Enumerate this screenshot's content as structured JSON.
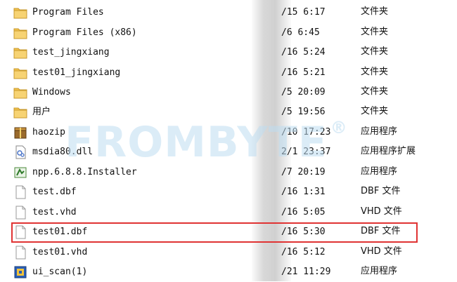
{
  "rows": [
    {
      "name": "Program Files",
      "date": "/15 6:17",
      "type": "文件夹",
      "icon": "folder-icon"
    },
    {
      "name": "Program Files (x86)",
      "date": "/6 6:45",
      "type": "文件夹",
      "icon": "folder-icon"
    },
    {
      "name": "test_jingxiang",
      "date": "/16 5:24",
      "type": "文件夹",
      "icon": "folder-icon"
    },
    {
      "name": "test01_jingxiang",
      "date": "/16 5:21",
      "type": "文件夹",
      "icon": "folder-icon"
    },
    {
      "name": "Windows",
      "date": "/5 20:09",
      "type": "文件夹",
      "icon": "folder-icon"
    },
    {
      "name": "用户",
      "date": "/5 19:56",
      "type": "文件夹",
      "icon": "folder-icon"
    },
    {
      "name": "haozip",
      "date": "/10 17:23",
      "type": "应用程序",
      "icon": "haozip-app-icon"
    },
    {
      "name": "msdia80.dll",
      "date": "2/1 23:37",
      "type": "应用程序扩展",
      "icon": "dll-file-icon"
    },
    {
      "name": "npp.6.8.8.Installer",
      "date": "/7 20:19",
      "type": "应用程序",
      "icon": "installer-app-icon"
    },
    {
      "name": "test.dbf",
      "date": "/16 1:31",
      "type": "DBF 文件",
      "icon": "blank-file-icon"
    },
    {
      "name": "test.vhd",
      "date": "/16 5:05",
      "type": "VHD 文件",
      "icon": "blank-file-icon"
    },
    {
      "name": "test01.dbf",
      "date": "/16 5:30",
      "type": "DBF 文件",
      "icon": "blank-file-icon"
    },
    {
      "name": "test01.vhd",
      "date": "/16 5:12",
      "type": "VHD 文件",
      "icon": "blank-file-icon"
    },
    {
      "name": "ui_scan(1)",
      "date": "/21 11:29",
      "type": "应用程序",
      "icon": "scan-app-icon"
    }
  ],
  "watermark": {
    "text": "FROMBYTE",
    "reg": "®"
  },
  "colors": {
    "highlight": "#e03333",
    "folder": "#f2c14e",
    "watermark": "#b9dcf0"
  }
}
